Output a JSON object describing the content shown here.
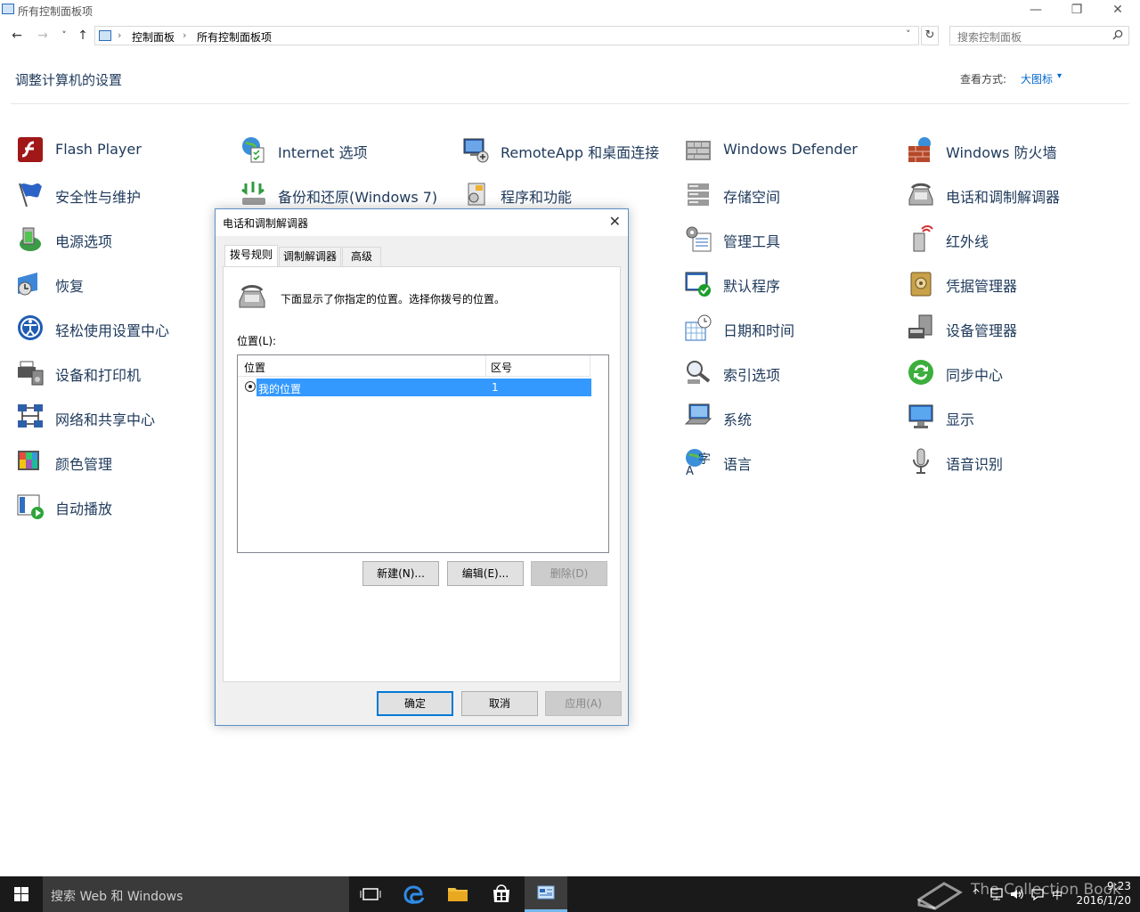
{
  "window": {
    "title": "所有控制面板项",
    "minimize_glyph": "—",
    "restore_glyph": "❐",
    "close_glyph": "✕"
  },
  "address": {
    "back_glyph": "←",
    "forward_glyph": "→",
    "recent_glyph": "˅",
    "up_glyph": "↑",
    "breadcrumb_sep": "›",
    "crumbs": [
      "控制面板",
      "所有控制面板项"
    ],
    "dropdown_glyph": "˅",
    "refresh_glyph": "↻",
    "search_placeholder": "搜索控制面板"
  },
  "header": {
    "title": "调整计算机的设置",
    "view_label": "查看方式:",
    "view_value": "大图标",
    "view_caret": "▾"
  },
  "items": [
    {
      "label": "Flash Player",
      "icon": "flash-player-icon"
    },
    {
      "label": "Internet 选项",
      "icon": "internet-options-icon"
    },
    {
      "label": "RemoteApp 和桌面连接",
      "icon": "remoteapp-icon"
    },
    {
      "label": "Windows Defender",
      "icon": "windows-defender-icon"
    },
    {
      "label": "Windows 防火墙",
      "icon": "firewall-icon"
    },
    {
      "label": "安全性与维护",
      "icon": "security-flag-icon"
    },
    {
      "label": "备份和还原(Windows 7)",
      "icon": "backup-restore-icon"
    },
    {
      "label": "程序和功能",
      "icon": "programs-features-icon"
    },
    {
      "label": "存储空间",
      "icon": "storage-spaces-icon"
    },
    {
      "label": "电话和调制解调器",
      "icon": "phone-modem-icon"
    },
    {
      "label": "电源选项",
      "icon": "power-options-icon"
    },
    {
      "label": "管理工具",
      "icon": "admin-tools-icon"
    },
    {
      "label": "红外线",
      "icon": "infrared-icon"
    },
    {
      "label": "恢复",
      "icon": "recovery-icon"
    },
    {
      "label": "默认程序",
      "icon": "default-programs-icon"
    },
    {
      "label": "凭据管理器",
      "icon": "credential-manager-icon"
    },
    {
      "label": "轻松使用设置中心",
      "icon": "ease-of-access-icon"
    },
    {
      "label": "日期和时间",
      "icon": "date-time-icon"
    },
    {
      "label": "设备管理器",
      "icon": "device-manager-icon"
    },
    {
      "label": "设备和打印机",
      "icon": "devices-printers-icon"
    },
    {
      "label": "索引选项",
      "icon": "indexing-options-icon"
    },
    {
      "label": "同步中心",
      "icon": "sync-center-icon"
    },
    {
      "label": "网络和共享中心",
      "icon": "network-sharing-icon"
    },
    {
      "label": "系统",
      "icon": "system-icon"
    },
    {
      "label": "显示",
      "icon": "display-icon"
    },
    {
      "label": "颜色管理",
      "icon": "color-management-icon"
    },
    {
      "label": "语言",
      "icon": "language-icon"
    },
    {
      "label": "语音识别",
      "icon": "speech-recognition-icon"
    },
    {
      "label": "自动播放",
      "icon": "autoplay-icon"
    }
  ],
  "dialog": {
    "title": "电话和调制解调器",
    "close_glyph": "✕",
    "tabs": [
      "拨号规则",
      "调制解调器",
      "高级"
    ],
    "description": "下面显示了你指定的位置。选择你拨号的位置。",
    "locations_label": "位置(L):",
    "columns": [
      "位置",
      "区号"
    ],
    "rows": [
      {
        "location": "我的位置",
        "area_code": "1"
      }
    ],
    "new_button": "新建(N)...",
    "edit_button": "编辑(E)...",
    "delete_button": "删除(D)",
    "ok_button": "确定",
    "cancel_button": "取消",
    "apply_button": "应用(A)"
  },
  "taskbar": {
    "search_placeholder": "搜索 Web 和 Windows",
    "tray_up_glyph": "^",
    "ime": "中",
    "time": "9:23",
    "date": "2016/1/20",
    "watermark": "The Collection Book"
  },
  "colors": {
    "link_blue": "#0066cc",
    "title_navy": "#1e395b",
    "selection_blue": "#3399ff",
    "taskbar": "#1a1a1a"
  }
}
